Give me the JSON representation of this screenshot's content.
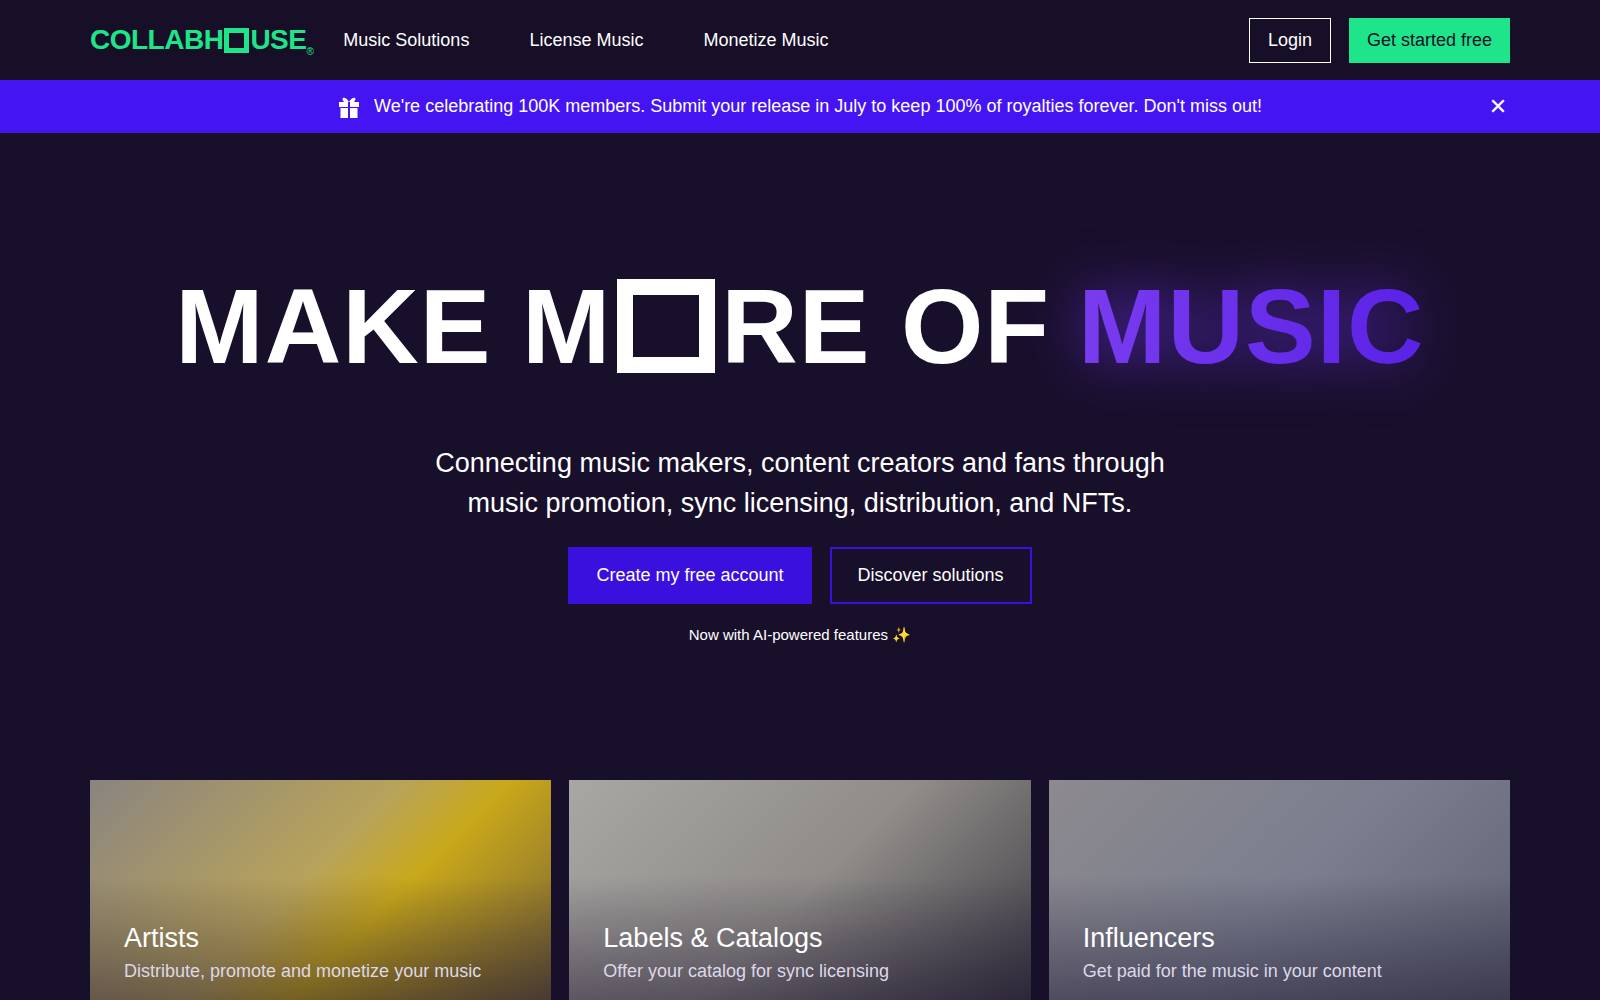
{
  "logo": {
    "before": "COLLABH",
    "after": "USE",
    "mark": "®"
  },
  "nav": {
    "links": [
      "Music Solutions",
      "License Music",
      "Monetize Music"
    ],
    "login": "Login",
    "start": "Get started free"
  },
  "banner": {
    "text": "We're celebrating 100K members. Submit your release in July to keep 100% of royalties forever. Don't miss out!",
    "close": "✕"
  },
  "hero": {
    "headline": {
      "before": "MAKE M",
      "after": "RE OF",
      "accent": "MUSIC"
    },
    "subtitle": [
      "Connecting music makers, content creators and fans through",
      "music promotion, sync licensing, distribution, and NFTs."
    ],
    "primary": "Create my free account",
    "secondary": "Discover solutions",
    "note": "Now with AI-powered features ✨"
  },
  "cards": [
    {
      "title": "Artists",
      "subtitle": "Distribute, promote and monetize your music"
    },
    {
      "title": "Labels & Catalogs",
      "subtitle": "Offer your catalog for sync licensing"
    },
    {
      "title": "Influencers",
      "subtitle": "Get paid for the music in your content"
    }
  ]
}
